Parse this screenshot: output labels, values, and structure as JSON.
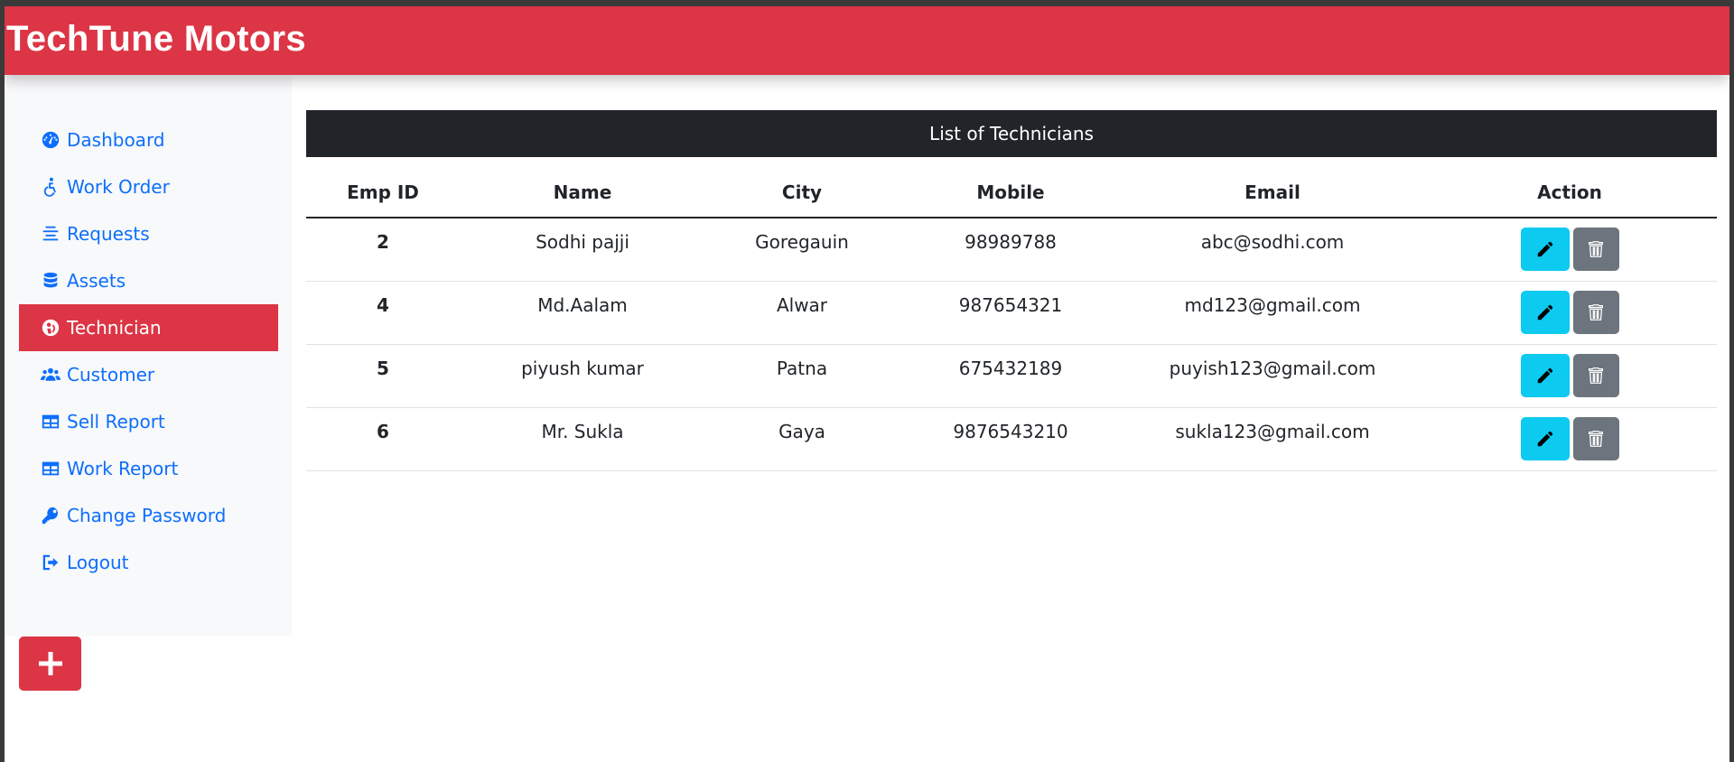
{
  "app": {
    "brand": "TechTune Motors"
  },
  "sidebar": {
    "items": [
      {
        "label": "Dashboard",
        "icon": "gauge-icon"
      },
      {
        "label": "Work Order",
        "icon": "accessible-icon"
      },
      {
        "label": "Requests",
        "icon": "align-center-icon"
      },
      {
        "label": "Assets",
        "icon": "database-icon"
      },
      {
        "label": "Technician",
        "icon": "technician-icon",
        "active": true
      },
      {
        "label": "Customer",
        "icon": "users-icon"
      },
      {
        "label": "Sell Report",
        "icon": "table-icon"
      },
      {
        "label": "Work Report",
        "icon": "table-icon"
      },
      {
        "label": "Change Password",
        "icon": "key-icon"
      },
      {
        "label": "Logout",
        "icon": "logout-icon"
      }
    ]
  },
  "main": {
    "title": "List of Technicians",
    "table": {
      "headers": [
        "Emp ID",
        "Name",
        "City",
        "Mobile",
        "Email",
        "Action"
      ],
      "rows": [
        [
          "2",
          "Sodhi pajji",
          "Goregauin",
          "98989788",
          "abc@sodhi.com"
        ],
        [
          "4",
          "Md.Aalam",
          "Alwar",
          "987654321",
          "md123@gmail.com"
        ],
        [
          "5",
          "piyush kumar",
          "Patna",
          "675432189",
          "puyish123@gmail.com"
        ],
        [
          "6",
          "Mr. Sukla",
          "Gaya",
          "9876543210",
          "sukla123@gmail.com"
        ]
      ]
    }
  },
  "colors": {
    "brand": "#dc3545",
    "header": "#212529",
    "edit": "#0dcaf0",
    "delete": "#6c757d",
    "link": "#0d6efd"
  }
}
